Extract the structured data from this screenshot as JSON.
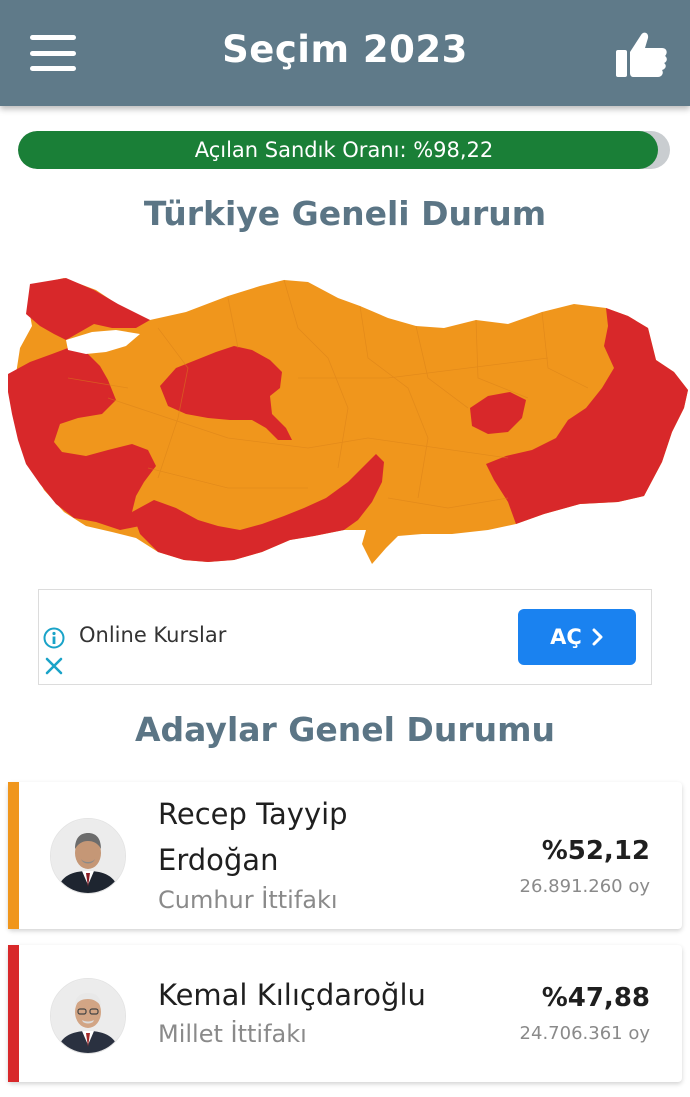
{
  "app": {
    "title": "Seçim 2023"
  },
  "icons": {
    "menu": "hamburger-menu-icon",
    "like": "thumbs-up-icon",
    "info": "info-icon",
    "close": "close-icon",
    "chevron": "chevron-right-icon"
  },
  "progress": {
    "label": "Açılan Sandık Oranı: %98,22",
    "value_percent": 98.22,
    "color": "#1a7f37"
  },
  "map_section": {
    "title": "Türkiye Geneli Durum",
    "colors": {
      "orange": "#f0961c",
      "red": "#d8282a"
    }
  },
  "ad": {
    "text": "Online Kurslar",
    "button_label": "AÇ"
  },
  "candidates_section": {
    "title": "Adaylar Genel Durumu",
    "candidates": [
      {
        "name_line1": "Recep Tayyip",
        "name_line2": "Erdoğan",
        "party": "Cumhur İttifakı",
        "percent": "%52,12",
        "votes": "26.891.260 oy",
        "color": "#f0961c"
      },
      {
        "name_line1": "Kemal Kılıçdaroğlu",
        "name_line2": "",
        "party": "Millet İttifakı",
        "percent": "%47,88",
        "votes": "24.706.361 oy",
        "color": "#d8282a"
      }
    ]
  }
}
